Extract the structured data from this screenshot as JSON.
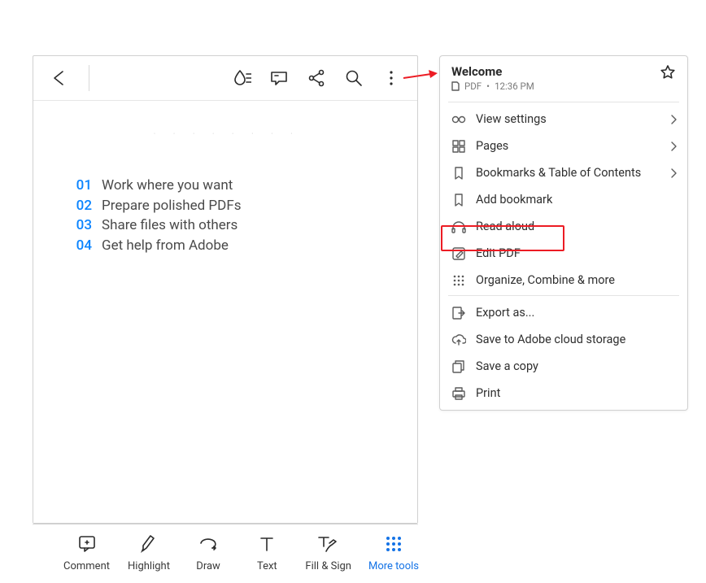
{
  "document": {
    "toc": [
      {
        "num": "01",
        "text": "Work where you want"
      },
      {
        "num": "02",
        "text": "Prepare polished PDFs"
      },
      {
        "num": "03",
        "text": "Share files with others"
      },
      {
        "num": "04",
        "text": "Get help from Adobe"
      }
    ]
  },
  "toolbar": {
    "items": [
      {
        "label": "Comment"
      },
      {
        "label": "Highlight"
      },
      {
        "label": "Draw"
      },
      {
        "label": "Text"
      },
      {
        "label": "Fill & Sign"
      },
      {
        "label": "More tools"
      }
    ]
  },
  "menu": {
    "title": "Welcome",
    "filetype": "PDF",
    "time": "12:36 PM",
    "sections": [
      [
        {
          "label": "View settings",
          "chevron": true
        },
        {
          "label": "Pages",
          "chevron": true
        },
        {
          "label": "Bookmarks & Table of Contents",
          "chevron": true
        },
        {
          "label": "Add bookmark"
        },
        {
          "label": "Read aloud"
        },
        {
          "label": "Edit PDF"
        },
        {
          "label": "Organize, Combine & more"
        }
      ],
      [
        {
          "label": "Export as..."
        },
        {
          "label": "Save to Adobe cloud storage"
        },
        {
          "label": "Save a copy"
        },
        {
          "label": "Print"
        }
      ]
    ]
  }
}
